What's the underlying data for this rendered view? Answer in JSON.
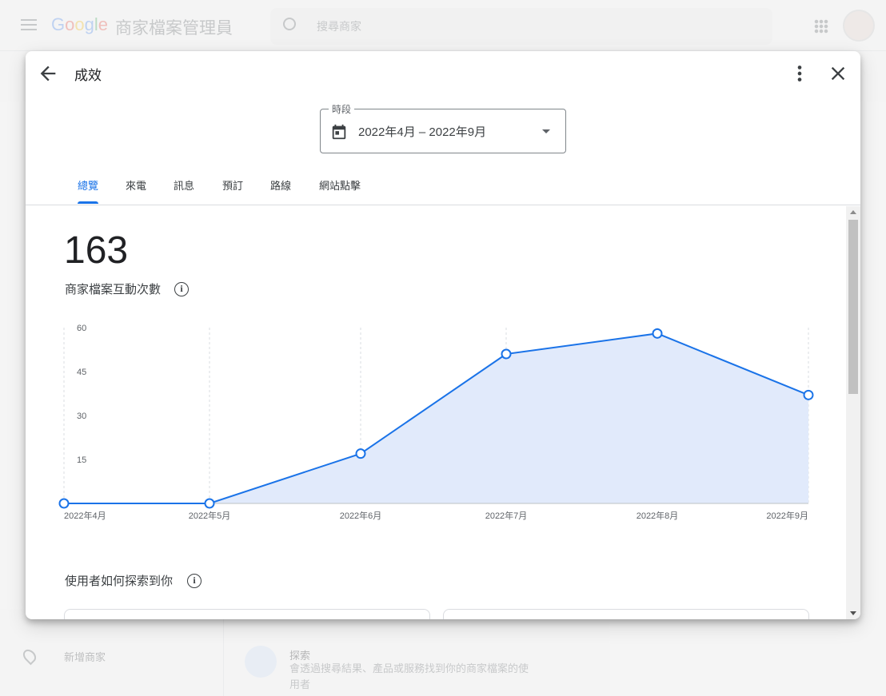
{
  "background": {
    "product_name": "商家檔案管理員",
    "search_placeholder": "搜尋商家",
    "add_business_label": "新增商家",
    "explore_title": "探索",
    "explore_desc": "會透過搜尋結果、產品或服務找到你的商家檔案的使用者"
  },
  "dialog": {
    "title": "成效",
    "period": {
      "legend": "時段",
      "value": "2022年4月 – 2022年9月"
    },
    "tabs": [
      "總覽",
      "來電",
      "訊息",
      "預訂",
      "路線",
      "網站點擊"
    ],
    "active_tab": 0,
    "summary": {
      "total": "163",
      "label": "商家檔案互動次數"
    },
    "section_title": "使用者如何探索到你"
  },
  "chart_data": {
    "type": "area",
    "categories": [
      "2022年4月",
      "2022年5月",
      "2022年6月",
      "2022年7月",
      "2022年8月",
      "2022年9月"
    ],
    "values": [
      0,
      0,
      17,
      51,
      58,
      37
    ],
    "yticks": [
      15,
      30,
      45,
      60
    ],
    "ylim": [
      0,
      60
    ],
    "grid": "vertical dashed",
    "line_color": "#1a73e8",
    "fill_color": "#e1eafb"
  }
}
